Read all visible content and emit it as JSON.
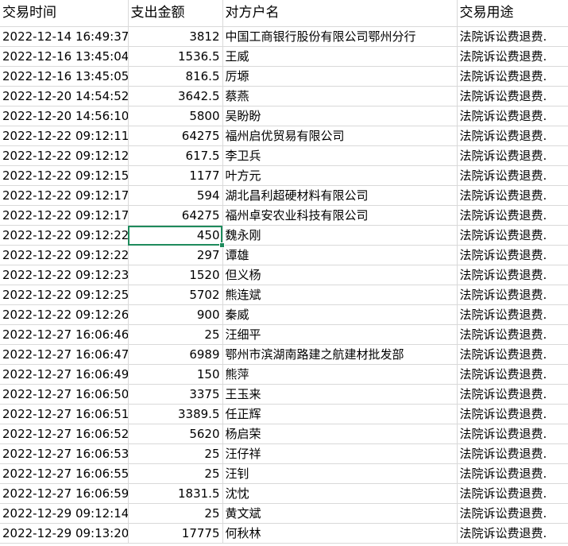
{
  "header": {
    "col_time": "交易时间",
    "col_amount": "支出金额",
    "col_party": "对方户名",
    "col_purpose": "交易用途"
  },
  "rows": [
    {
      "time": "2022-12-14 16:49:37",
      "amount": "3812",
      "party": "中国工商银行股份有限公司鄂州分行",
      "purpose": "法院诉讼费退费."
    },
    {
      "time": "2022-12-16 13:45:04",
      "amount": "1536.5",
      "party": "王威",
      "purpose": "法院诉讼费退费."
    },
    {
      "time": "2022-12-16 13:45:05",
      "amount": "816.5",
      "party": "厉塬",
      "purpose": "法院诉讼费退费."
    },
    {
      "time": "2022-12-20 14:54:52",
      "amount": "3642.5",
      "party": "蔡燕",
      "purpose": "法院诉讼费退费."
    },
    {
      "time": "2022-12-20 14:56:10",
      "amount": "5800",
      "party": "吴盼盼",
      "purpose": "法院诉讼费退费."
    },
    {
      "time": "2022-12-22 09:12:11",
      "amount": "64275",
      "party": "福州启优贸易有限公司",
      "purpose": "法院诉讼费退费."
    },
    {
      "time": "2022-12-22 09:12:12",
      "amount": "617.5",
      "party": "李卫兵",
      "purpose": "法院诉讼费退费."
    },
    {
      "time": "2022-12-22 09:12:15",
      "amount": "1177",
      "party": "叶方元",
      "purpose": "法院诉讼费退费."
    },
    {
      "time": "2022-12-22 09:12:17",
      "amount": "594",
      "party": "湖北昌利超硬材料有限公司",
      "purpose": "法院诉讼费退费."
    },
    {
      "time": "2022-12-22 09:12:17",
      "amount": "64275",
      "party": "福州卓安农业科技有限公司",
      "purpose": "法院诉讼费退费."
    },
    {
      "time": "2022-12-22 09:12:22",
      "amount": "450",
      "party": "魏永刚",
      "purpose": "法院诉讼费退费."
    },
    {
      "time": "2022-12-22 09:12:22",
      "amount": "297",
      "party": "谭雄",
      "purpose": "法院诉讼费退费."
    },
    {
      "time": "2022-12-22 09:12:23",
      "amount": "1520",
      "party": "但义杨",
      "purpose": "法院诉讼费退费."
    },
    {
      "time": "2022-12-22 09:12:25",
      "amount": "5702",
      "party": "熊连斌",
      "purpose": "法院诉讼费退费."
    },
    {
      "time": "2022-12-22 09:12:26",
      "amount": "900",
      "party": "秦威",
      "purpose": "法院诉讼费退费."
    },
    {
      "time": "2022-12-27 16:06:46",
      "amount": "25",
      "party": "汪细平",
      "purpose": "法院诉讼费退费."
    },
    {
      "time": "2022-12-27 16:06:47",
      "amount": "6989",
      "party": "鄂州市滨湖南路建之航建材批发部",
      "purpose": "法院诉讼费退费."
    },
    {
      "time": "2022-12-27 16:06:49",
      "amount": "150",
      "party": "熊萍",
      "purpose": "法院诉讼费退费."
    },
    {
      "time": "2022-12-27 16:06:50",
      "amount": "3375",
      "party": "王玉来",
      "purpose": "法院诉讼费退费."
    },
    {
      "time": "2022-12-27 16:06:51",
      "amount": "3389.5",
      "party": "任正辉",
      "purpose": "法院诉讼费退费."
    },
    {
      "time": "2022-12-27 16:06:52",
      "amount": "5620",
      "party": "杨启荣",
      "purpose": "法院诉讼费退费."
    },
    {
      "time": "2022-12-27 16:06:53",
      "amount": "25",
      "party": "汪仔祥",
      "purpose": "法院诉讼费退费."
    },
    {
      "time": "2022-12-27 16:06:55",
      "amount": "25",
      "party": "汪钊",
      "purpose": "法院诉讼费退费."
    },
    {
      "time": "2022-12-27 16:06:59",
      "amount": "1831.5",
      "party": "沈忱",
      "purpose": "法院诉讼费退费."
    },
    {
      "time": "2022-12-29 09:12:14",
      "amount": "25",
      "party": "黄文斌",
      "purpose": "法院诉讼费退费."
    },
    {
      "time": "2022-12-29 09:13:20",
      "amount": "17775",
      "party": "何秋林",
      "purpose": "法院诉讼费退费."
    }
  ],
  "selection": {
    "row_index": 10,
    "column": "amount",
    "color": "#1e8b5c"
  }
}
